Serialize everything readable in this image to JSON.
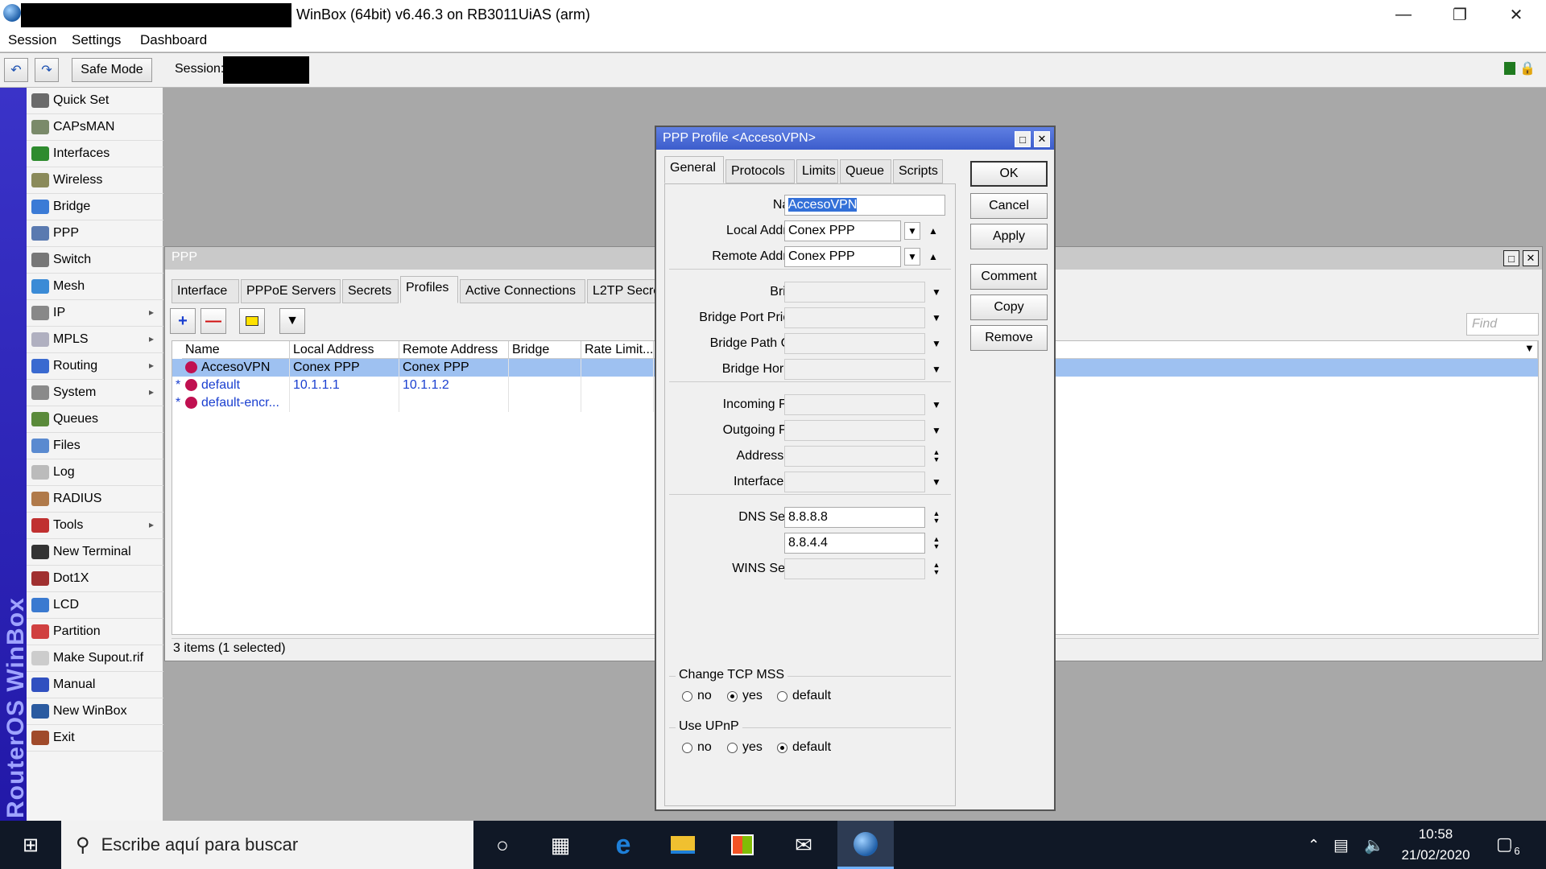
{
  "titlebar": {
    "title": "WinBox (64bit) v6.46.3 on RB3011UiAS (arm)"
  },
  "menu": [
    "Session",
    "Settings",
    "Dashboard"
  ],
  "toolbar": {
    "safe_mode": "Safe Mode",
    "session_label": "Session:"
  },
  "brand": "RouterOS WinBox",
  "sidebar": [
    {
      "label": "Quick Set",
      "icon": "quickset-icon",
      "color": "#6a6a6a",
      "arrow": false
    },
    {
      "label": "CAPsMAN",
      "icon": "capsman-icon",
      "color": "#7a8a6a",
      "arrow": false
    },
    {
      "label": "Interfaces",
      "icon": "interfaces-icon",
      "color": "#2e8b2e",
      "arrow": false
    },
    {
      "label": "Wireless",
      "icon": "wireless-icon",
      "color": "#8a8a5a",
      "arrow": false
    },
    {
      "label": "Bridge",
      "icon": "bridge-icon",
      "color": "#3b7bd6",
      "arrow": false
    },
    {
      "label": "PPP",
      "icon": "ppp-icon",
      "color": "#5a7ab0",
      "arrow": false
    },
    {
      "label": "Switch",
      "icon": "switch-icon",
      "color": "#777",
      "arrow": false
    },
    {
      "label": "Mesh",
      "icon": "mesh-icon",
      "color": "#3b8bd6",
      "arrow": false
    },
    {
      "label": "IP",
      "icon": "ip-icon",
      "color": "#888",
      "arrow": true
    },
    {
      "label": "MPLS",
      "icon": "mpls-icon",
      "color": "#b0b0c0",
      "arrow": true
    },
    {
      "label": "Routing",
      "icon": "routing-icon",
      "color": "#3a6ad0",
      "arrow": true
    },
    {
      "label": "System",
      "icon": "system-icon",
      "color": "#8a8a8a",
      "arrow": true
    },
    {
      "label": "Queues",
      "icon": "queues-icon",
      "color": "#5a8a3a",
      "arrow": false
    },
    {
      "label": "Files",
      "icon": "files-icon",
      "color": "#5a8ad0",
      "arrow": false
    },
    {
      "label": "Log",
      "icon": "log-icon",
      "color": "#bbb",
      "arrow": false
    },
    {
      "label": "RADIUS",
      "icon": "radius-icon",
      "color": "#b07a4a",
      "arrow": false
    },
    {
      "label": "Tools",
      "icon": "tools-icon",
      "color": "#c03030",
      "arrow": true
    },
    {
      "label": "New Terminal",
      "icon": "terminal-icon",
      "color": "#333",
      "arrow": false
    },
    {
      "label": "Dot1X",
      "icon": "dot1x-icon",
      "color": "#a03030",
      "arrow": false
    },
    {
      "label": "LCD",
      "icon": "lcd-icon",
      "color": "#3a7ad0",
      "arrow": false
    },
    {
      "label": "Partition",
      "icon": "partition-icon",
      "color": "#d04040",
      "arrow": false
    },
    {
      "label": "Make Supout.rif",
      "icon": "supout-icon",
      "color": "#ccc",
      "arrow": false
    },
    {
      "label": "Manual",
      "icon": "manual-icon",
      "color": "#3050c0",
      "arrow": false
    },
    {
      "label": "New WinBox",
      "icon": "winbox-icon",
      "color": "#2a5aa0",
      "arrow": false
    },
    {
      "label": "Exit",
      "icon": "exit-icon",
      "color": "#a04a2a",
      "arrow": false
    }
  ],
  "ppp_window": {
    "title": "PPP",
    "tabs": [
      "Interface",
      "PPPoE Servers",
      "Secrets",
      "Profiles",
      "Active Connections",
      "L2TP Secrets"
    ],
    "active_tab": "Profiles",
    "find_placeholder": "Find",
    "columns": [
      "Name",
      "Local Address",
      "Remote Address",
      "Bridge",
      "Rate Limit..."
    ],
    "rows": [
      {
        "marker": "",
        "name": "AccesoVPN",
        "local": "Conex PPP",
        "remote": "Conex PPP",
        "bridge": "",
        "rate": "",
        "selected": true
      },
      {
        "marker": "*",
        "name": "default",
        "local": "10.1.1.1",
        "remote": "10.1.1.2",
        "bridge": "",
        "rate": "",
        "selected": false
      },
      {
        "marker": "*",
        "name": "default-encr...",
        "local": "",
        "remote": "",
        "bridge": "",
        "rate": "",
        "selected": false
      }
    ],
    "status": "3 items (1 selected)"
  },
  "dialog": {
    "title": "PPP Profile <AccesoVPN>",
    "tabs": [
      "General",
      "Protocols",
      "Limits",
      "Queue",
      "Scripts"
    ],
    "active_tab": "General",
    "buttons": [
      "OK",
      "Cancel",
      "Apply",
      "Comment",
      "Copy",
      "Remove"
    ],
    "fields": {
      "name_label": "Name:",
      "name_value": "AccesoVPN",
      "local_label": "Local Address:",
      "local_value": "Conex PPP",
      "remote_label": "Remote Address:",
      "remote_value": "Conex PPP",
      "bridge_label": "Bridge:",
      "bpp_label": "Bridge Port Priority:",
      "bpc_label": "Bridge Path Cost:",
      "bh_label": "Bridge Horizon:",
      "in_label": "Incoming Filter:",
      "out_label": "Outgoing Filter:",
      "al_label": "Address List:",
      "il_label": "Interface List:",
      "dns_label": "DNS Server:",
      "dns1": "8.8.8.8",
      "dns2": "8.8.4.4",
      "wins_label": "WINS Server:"
    },
    "change_tcp_mss": {
      "label": "Change TCP MSS",
      "options": [
        "no",
        "yes",
        "default"
      ],
      "selected": "yes"
    },
    "use_upnp": {
      "label": "Use UPnP",
      "options": [
        "no",
        "yes",
        "default"
      ],
      "selected": "default"
    }
  },
  "taskbar": {
    "search_placeholder": "Escribe aquí para buscar",
    "time": "10:58",
    "date": "21/02/2020",
    "notifications": "6"
  }
}
